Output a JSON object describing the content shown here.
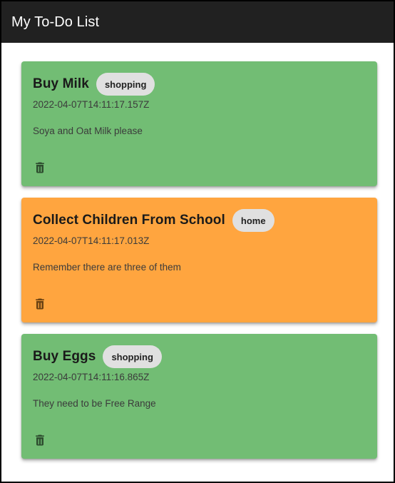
{
  "app": {
    "title": "My To-Do List"
  },
  "colors": {
    "app_bar": "#212121",
    "card_green": "#72bd74",
    "card_orange": "#ffa53f",
    "chip": "#e0e0e0",
    "icon_green_card": "#2e4d2f",
    "icon_orange_card": "#6b4212"
  },
  "todos": [
    {
      "title": "Buy Milk",
      "tag": "shopping",
      "timestamp": "2022-04-07T14:11:17.157Z",
      "description": "Soya and Oat Milk please",
      "color": "#72bd74",
      "delete_icon": "trash-icon"
    },
    {
      "title": "Collect Children From School",
      "tag": "home",
      "timestamp": "2022-04-07T14:11:17.013Z",
      "description": "Remember there are three of them",
      "color": "#ffa53f",
      "delete_icon": "trash-icon"
    },
    {
      "title": "Buy Eggs",
      "tag": "shopping",
      "timestamp": "2022-04-07T14:11:16.865Z",
      "description": "They need to be Free Range",
      "color": "#72bd74",
      "delete_icon": "trash-icon"
    }
  ]
}
